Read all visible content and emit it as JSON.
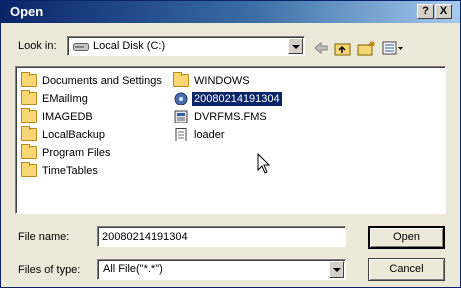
{
  "dialog": {
    "title": "Open",
    "help_button": "?",
    "close_button": "X"
  },
  "toolbar": {
    "look_in_label": "Look in:",
    "look_in_value": "Local Disk (C:)"
  },
  "files": {
    "left_column": [
      {
        "name": "Documents and Settings",
        "icon": "folder-icon"
      },
      {
        "name": "EMailImg",
        "icon": "folder-icon"
      },
      {
        "name": "IMAGEDB",
        "icon": "folder-icon"
      },
      {
        "name": "LocalBackup",
        "icon": "folder-icon"
      },
      {
        "name": "Program Files",
        "icon": "folder-icon"
      },
      {
        "name": "TimeTables",
        "icon": "folder-icon"
      }
    ],
    "right_column": [
      {
        "name": "WINDOWS",
        "icon": "folder-icon"
      },
      {
        "name": "20080214191304",
        "icon": "media-file-icon",
        "selected": true
      },
      {
        "name": "DVRFMS.FMS",
        "icon": "system-file-icon"
      },
      {
        "name": "loader",
        "icon": "text-file-icon"
      }
    ]
  },
  "form": {
    "file_name_label": "File name:",
    "file_name_value": "20080214191304",
    "file_type_label": "Files of type:",
    "file_type_value": "All File(\"*.*\")",
    "open_button": "Open",
    "cancel_button": "Cancel"
  }
}
